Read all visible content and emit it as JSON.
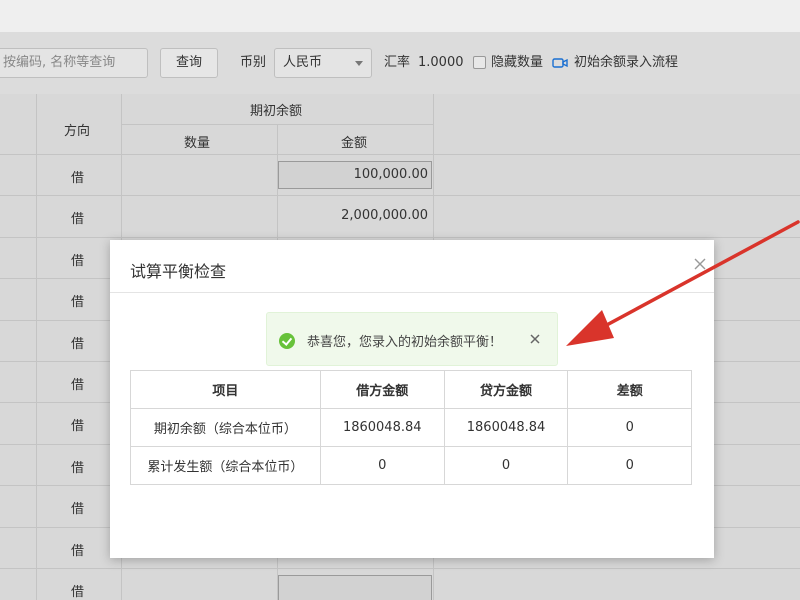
{
  "toolbar": {
    "search_placeholder": "按编码, 名称等查询",
    "query_label": "查询",
    "currency_label": "币别",
    "currency_value": "人民币",
    "rate_label": "汇率",
    "rate_value": "1.0000",
    "hide_qty_label": "隐藏数量",
    "flow_link": "初始余额录入流程"
  },
  "grid": {
    "header_direction": "方向",
    "header_opening": "期初余额",
    "header_qty": "数量",
    "header_amount": "金额",
    "rows": [
      {
        "direction": "借",
        "amount": "100,000.00"
      },
      {
        "direction": "借",
        "amount": "2,000,000.00"
      },
      {
        "direction": "借",
        "amount": ""
      },
      {
        "direction": "借",
        "amount": ""
      },
      {
        "direction": "借",
        "amount": ""
      },
      {
        "direction": "借",
        "amount": ""
      },
      {
        "direction": "借",
        "amount": ""
      },
      {
        "direction": "借",
        "amount": ""
      },
      {
        "direction": "借",
        "amount": ""
      },
      {
        "direction": "借",
        "amount": ""
      },
      {
        "direction": "借",
        "amount": ""
      }
    ]
  },
  "modal": {
    "title": "试算平衡检查",
    "toast_message": "恭喜您，您录入的初始余额平衡！",
    "table": {
      "headers": [
        "项目",
        "借方金额",
        "贷方金额",
        "差额"
      ],
      "rows": [
        [
          "期初余额（综合本位币）",
          "1860048.84",
          "1860048.84",
          "0"
        ],
        [
          "累计发生额（综合本位币）",
          "0",
          "0",
          "0"
        ]
      ]
    }
  },
  "colors": {
    "success": "#67c23a",
    "toast_bg": "#f0f9eb",
    "arrow": "#d9342b"
  }
}
